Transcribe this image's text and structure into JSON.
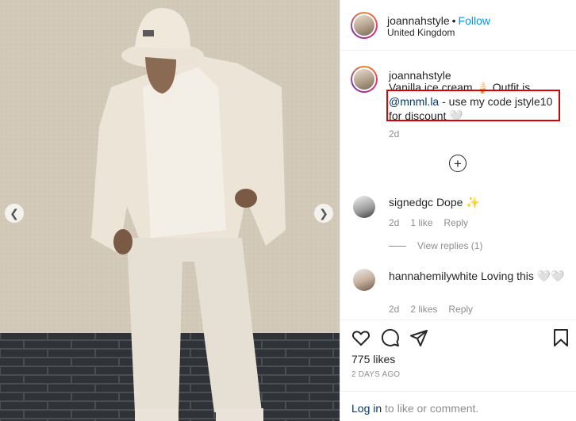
{
  "post": {
    "username": "joannahstyle",
    "separator": "•",
    "follow_label": "Follow",
    "location": "United Kingdom"
  },
  "caption": {
    "username": "joannahstyle",
    "line1": "Vanilla ice cream 🍦 Outfit is",
    "mention": "@mnml.la",
    "line2_rest": " - use my code jstyle10 for discount 🤍",
    "time": "2d"
  },
  "comments": [
    {
      "username": "signedgc",
      "text": "Dope ✨",
      "time": "2d",
      "likes": "1 like",
      "reply": "Reply"
    },
    {
      "username": "hannahemilywhite",
      "text": "Loving this 🤍🤍",
      "time": "2d",
      "likes": "2 likes",
      "reply": "Reply"
    }
  ],
  "view_replies_label": "View replies (1)",
  "likes_label": "775 likes",
  "posted_ago": "2 DAYS AGO",
  "login": {
    "link": "Log in",
    "rest": " to like or comment."
  },
  "icons": {
    "like": "heart-icon",
    "comment": "comment-icon",
    "share": "share-icon",
    "save": "bookmark-icon",
    "more": "plus-circle-icon",
    "prev": "chevron-left-icon",
    "next": "chevron-right-icon"
  },
  "colors": {
    "follow": "#0095f6",
    "highlight": "#e10000",
    "mention": "#00376b"
  }
}
